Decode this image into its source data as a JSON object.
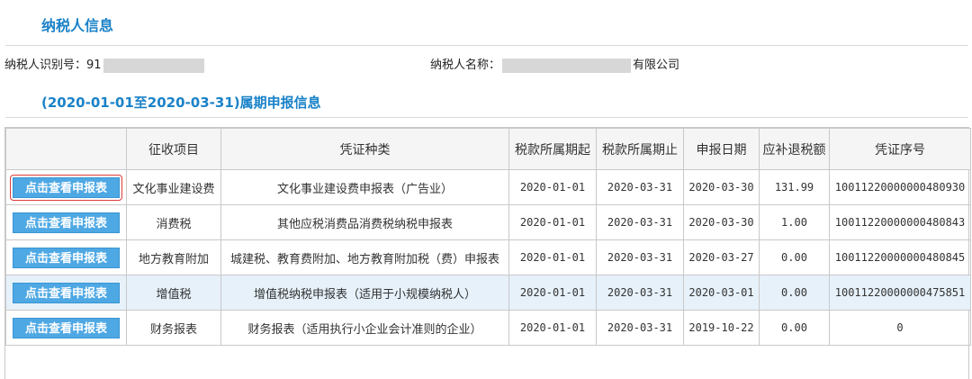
{
  "header": {
    "title": "纳税人信息"
  },
  "taxpayer": {
    "id_label": "纳税人识别号：",
    "id_visible_prefix": "91",
    "name_label": "纳税人名称：",
    "name_visible_suffix": "有限公司"
  },
  "period": {
    "title": "(2020-01-01至2020-03-31)属期申报信息"
  },
  "table": {
    "columns": [
      "",
      "征收项目",
      "凭证种类",
      "税款所属期起",
      "税款所属期止",
      "申报日期",
      "应补退税额",
      "凭证序号"
    ],
    "rows": [
      {
        "button": "点击查看申报表",
        "item": "文化事业建设费",
        "voucher_type": "文化事业建设费申报表（广告业）",
        "period_start": "2020-01-01",
        "period_end": "2020-03-31",
        "declare_date": "2020-03-30",
        "amount": "131.99",
        "voucher_no": "10011220000000480930"
      },
      {
        "button": "点击查看申报表",
        "item": "消费税",
        "voucher_type": "其他应税消费品消费税纳税申报表",
        "period_start": "2020-01-01",
        "period_end": "2020-03-31",
        "declare_date": "2020-03-30",
        "amount": "1.00",
        "voucher_no": "10011220000000480843"
      },
      {
        "button": "点击查看申报表",
        "item": "地方教育附加",
        "voucher_type": "城建税、教育费附加、地方教育附加税（费）申报表",
        "period_start": "2020-01-01",
        "period_end": "2020-03-31",
        "declare_date": "2020-03-27",
        "amount": "0.00",
        "voucher_no": "10011220000000480845"
      },
      {
        "button": "点击查看申报表",
        "item": "增值税",
        "voucher_type": "增值税纳税申报表（适用于小规模纳税人）",
        "period_start": "2020-01-01",
        "period_end": "2020-03-31",
        "declare_date": "2020-03-01",
        "amount": "0.00",
        "voucher_no": "10011220000000475851"
      },
      {
        "button": "点击查看申报表",
        "item": "财务报表",
        "voucher_type": "财务报表（适用执行小企业会计准则的企业）",
        "period_start": "2020-01-01",
        "period_end": "2020-03-31",
        "declare_date": "2019-10-22",
        "amount": "0.00",
        "voucher_no": "0"
      }
    ]
  },
  "colors": {
    "accent": "#1a82c8",
    "button": "#4ea8e4",
    "highlight_row": "#e6f1fa",
    "focus_outline": "#e03a3a"
  }
}
